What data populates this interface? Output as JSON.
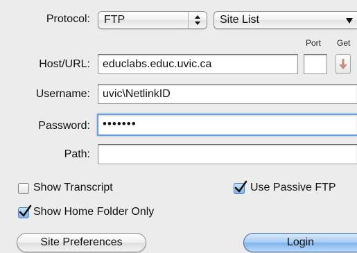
{
  "form": {
    "protocol": {
      "label": "Protocol:",
      "value": "FTP"
    },
    "site_list": {
      "value": "Site List"
    },
    "port_label": "Port",
    "get_label": "Get",
    "host": {
      "label": "Host/URL:",
      "value": "educlabs.educ.uvic.ca"
    },
    "port": {
      "value": ""
    },
    "username": {
      "label": "Username:",
      "value": "uvic\\NetlinkID"
    },
    "password": {
      "label": "Password:",
      "value": "•••••••"
    },
    "path": {
      "label": "Path:",
      "value": ""
    }
  },
  "options": {
    "show_transcript": {
      "label": "Show Transcript",
      "checked": false
    },
    "use_passive_ftp": {
      "label": "Use Passive FTP",
      "checked": true
    },
    "show_home_folder_only": {
      "label": "Show Home Folder Only",
      "checked": true
    }
  },
  "buttons": {
    "site_preferences": "Site Preferences",
    "login": "Login"
  },
  "colors": {
    "focus_ring": "#6d9fd6",
    "check_accent": "#4f7fb8"
  }
}
